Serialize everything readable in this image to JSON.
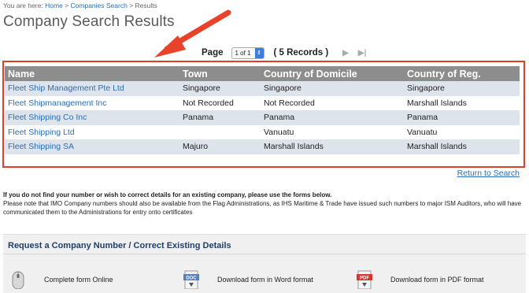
{
  "breadcrumb": {
    "prefix": "You are here:",
    "home": "Home",
    "companies": "Companies Search",
    "current": "Results",
    "separator": ">"
  },
  "title": "Company Search Results",
  "pager": {
    "label": "Page",
    "selected": "1 of 1",
    "records": "( 5 Records )"
  },
  "table": {
    "columns": [
      "Name",
      "Town",
      "Country of Domicile",
      "Country of Reg."
    ],
    "rows": [
      {
        "name": "Fleet Ship Management Pte Ltd",
        "town": "Singapore",
        "domicile": "Singapore",
        "reg": "Singapore"
      },
      {
        "name": "Fleet Shipmanagement Inc",
        "town": "Not Recorded",
        "domicile": "Not Recorded",
        "reg": "Marshall Islands"
      },
      {
        "name": "Fleet Shipping Co Inc",
        "town": "Panama",
        "domicile": "Panama",
        "reg": "Panama"
      },
      {
        "name": "Fleet Shipping Ltd",
        "town": "",
        "domicile": "Vanuatu",
        "reg": "Vanuatu"
      },
      {
        "name": "Fleet Shipping SA",
        "town": "Majuro",
        "domicile": "Marshall Islands",
        "reg": "Marshall Islands"
      }
    ]
  },
  "return_link": "Return to Search",
  "notice": {
    "line1": "If you do not find your number or wish to correct details for an existing company, please use the forms below.",
    "line2": "Please note that IMO Company numbers should also be available from the Flag Administrations, as IHS Maritime & Trade have issued such numbers to major ISM Auditors, who will have communicated them to the Administrations for entry onto certificates"
  },
  "panel": {
    "heading": "Request a Company Number / Correct Existing Details",
    "options": [
      {
        "label": "Complete form Online",
        "icon": "mouse-icon"
      },
      {
        "label": "Download form in Word format",
        "icon": "doc-file-icon",
        "badge": "DOC"
      },
      {
        "label": "Download form in PDF format",
        "icon": "pdf-file-icon",
        "badge": "PDF"
      }
    ]
  },
  "colors": {
    "link": "#2a6fb5",
    "header_bg": "#8d8d8d",
    "row_alt": "#dde4ec",
    "highlight": "#e0402a"
  }
}
